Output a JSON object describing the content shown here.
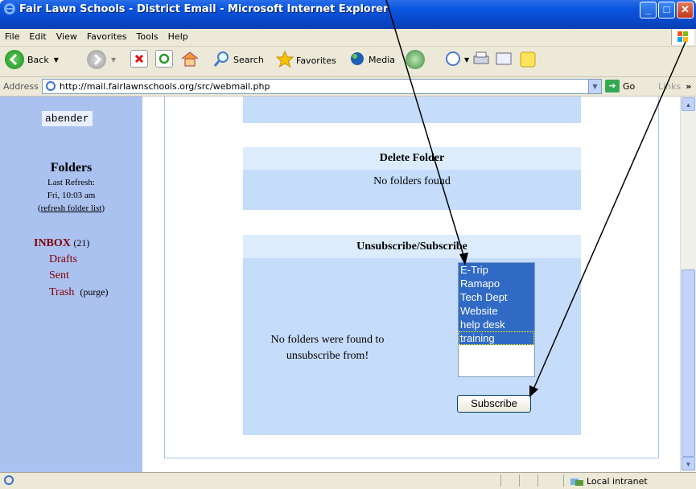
{
  "window": {
    "title": "Fair Lawn Schools - District Email - Microsoft Internet Explorer"
  },
  "menu": [
    "File",
    "Edit",
    "View",
    "Favorites",
    "Tools",
    "Help"
  ],
  "toolbar": {
    "back": "Back",
    "search": "Search",
    "favorites": "Favorites",
    "media": "Media"
  },
  "address": {
    "label": "Address",
    "url": "http://mail.fairlawnschools.org/src/webmail.php",
    "go": "Go",
    "links": "Links"
  },
  "sidebar": {
    "username": "abender",
    "folders_heading": "Folders",
    "last_refresh_label": "Last Refresh:",
    "last_refresh_time": "Fri, 10:03 am",
    "refresh_link": "refresh folder list",
    "inbox": "INBOX",
    "inbox_count": "(21)",
    "drafts": "Drafts",
    "sent": "Sent",
    "trash": "Trash",
    "purge": "(purge)"
  },
  "main": {
    "delete_folder_title": "Delete Folder",
    "delete_folder_msg": "No folders found",
    "unsub_title": "Unsubscribe/Subscribe",
    "unsub_msg": "No folders were found to unsubscribe from!",
    "subscribe_options": [
      "E-Trip",
      "Ramapo",
      "Tech Dept",
      "Website",
      "help desk",
      "training"
    ],
    "subscribe_button": "Subscribe"
  },
  "status": {
    "zone": "Local intranet"
  }
}
